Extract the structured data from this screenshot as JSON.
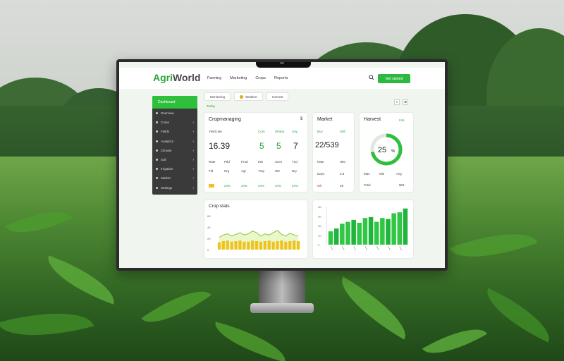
{
  "app": {
    "brand_part1": "Agri",
    "brand_part2": "World",
    "nav": [
      "Farming",
      "Marketing",
      "Crops",
      "Reports"
    ],
    "cta_label": "Get started",
    "camera_label": "cam"
  },
  "sidebar": {
    "active_label": "Dashboard",
    "items": [
      "Overview",
      "Crops",
      "Fields",
      "Analytics",
      "Climate",
      "Soil",
      "Irrigation",
      "Market",
      "Settings"
    ]
  },
  "chips": {
    "items": [
      "Monitoring",
      "Weather",
      "Harvest"
    ],
    "sub_label": "Today"
  },
  "mini_icons": [
    "≡",
    "⊞"
  ],
  "card_crop": {
    "title": "Cropmanaging",
    "corner": "$",
    "sub_left": "Yield rate",
    "col_heads": [
      "Corn",
      "Wheat",
      "Soy"
    ],
    "big_main": "16.39",
    "big_cols": [
      "5",
      "5",
      "7"
    ],
    "row1": [
      "Rate",
      "Ptld",
      "Prod",
      "Mix",
      "Scen",
      "Tnd"
    ],
    "row2": [
      "Fld",
      "Nrg",
      "Agr",
      "Tmp",
      "Wtr",
      "Dry"
    ],
    "row3": [
      "24%",
      "24%",
      "24%",
      "24%",
      "24%"
    ]
  },
  "card_market": {
    "title": "Market",
    "col_heads": [
      "Buy",
      "Sell"
    ],
    "big": "22/539",
    "rows": [
      [
        "Rate",
        "Hist"
      ],
      [
        "Days",
        "3.8"
      ],
      [
        "Wk",
        "48"
      ]
    ]
  },
  "card_harvest": {
    "title": "Harvest",
    "corner": "Info",
    "donut_label": "25",
    "donut_unit": "%",
    "donut_percent": 72,
    "rows": [
      [
        "Max",
        "Min",
        "Avg"
      ],
      [
        "Total",
        "",
        "$23"
      ]
    ]
  },
  "card_crop_stats": {
    "title": "Crop stats"
  },
  "colors": {
    "accent": "#2fbf3c",
    "accent_dark": "#2fa53a",
    "bar_yellow": "#f1c21b",
    "sidebar_bg": "#3a3a3a"
  },
  "chart_data": [
    {
      "type": "area",
      "title": "Crop stats",
      "categories": [
        "1",
        "2",
        "3",
        "4",
        "5",
        "6",
        "7",
        "8",
        "9",
        "10",
        "11",
        "12",
        "13",
        "14",
        "15",
        "16",
        "17",
        "18",
        "19",
        "20"
      ],
      "series": [
        {
          "values": [
            22,
            26,
            28,
            24,
            27,
            30,
            26,
            28,
            33,
            30,
            24,
            28,
            26,
            30,
            34,
            27,
            24,
            29,
            26,
            24
          ]
        }
      ],
      "bars": [
        13,
        15,
        16,
        14,
        15,
        16,
        14,
        14,
        16,
        15,
        14,
        15,
        16,
        14,
        15,
        16,
        14,
        15,
        16,
        15
      ],
      "ylim": [
        0,
        60
      ],
      "yticks": [
        "60",
        "40",
        "20",
        "0"
      ]
    },
    {
      "type": "bar",
      "categories": [
        "a",
        "b",
        "c",
        "d",
        "e",
        "f",
        "g",
        "h",
        "i",
        "j",
        "k",
        "l",
        "m",
        "n"
      ],
      "series": [
        {
          "values": [
            14,
            17,
            22,
            24,
            26,
            23,
            28,
            29,
            24,
            28,
            27,
            33,
            34,
            38
          ]
        }
      ],
      "ylim": [
        0,
        40
      ],
      "yticks": [
        "40",
        "30",
        "20",
        "10",
        "0"
      ]
    }
  ]
}
